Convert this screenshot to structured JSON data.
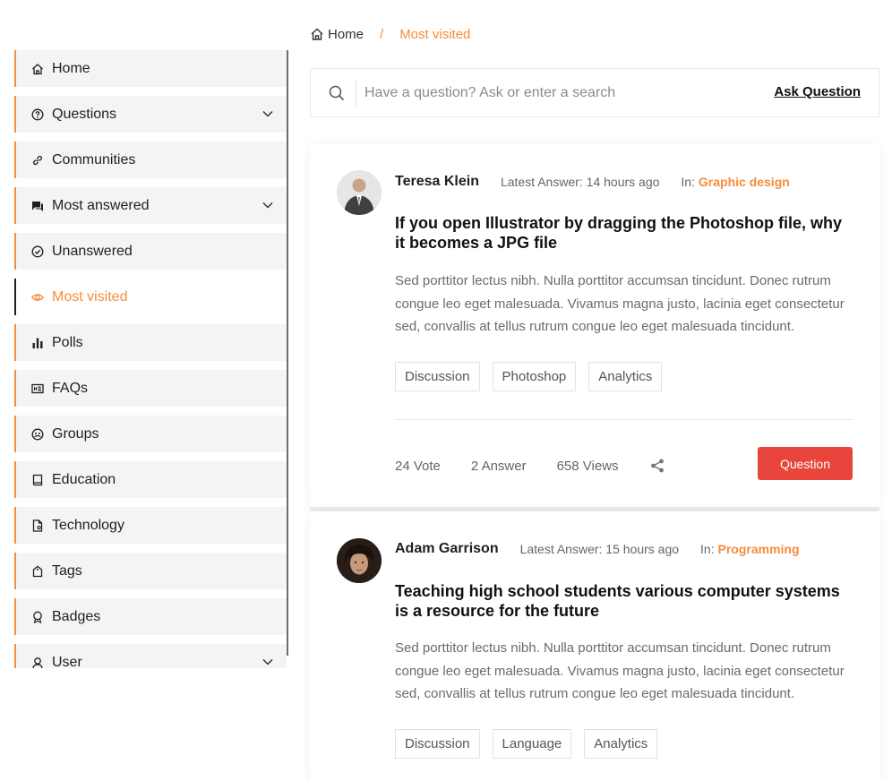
{
  "breadcrumb": {
    "home": "Home",
    "separator": "/",
    "current": "Most visited"
  },
  "search": {
    "placeholder": "Have a question? Ask or enter a search",
    "ask_label": "Ask Question"
  },
  "sidebar": {
    "items": [
      {
        "label": "Home",
        "icon": "home-icon"
      },
      {
        "label": "Questions",
        "icon": "question-icon",
        "expandable": true
      },
      {
        "label": "Communities",
        "icon": "link-icon"
      },
      {
        "label": "Most answered",
        "icon": "chat-icon",
        "expandable": true
      },
      {
        "label": "Unanswered",
        "icon": "check-circle-icon"
      },
      {
        "label": "Most visited",
        "icon": "eye-icon",
        "active": true
      },
      {
        "label": "Polls",
        "icon": "bar-chart-icon"
      },
      {
        "label": "FAQs",
        "icon": "faq-icon"
      },
      {
        "label": "Groups",
        "icon": "groups-icon"
      },
      {
        "label": "Education",
        "icon": "book-icon"
      },
      {
        "label": "Technology",
        "icon": "document-icon"
      },
      {
        "label": "Tags",
        "icon": "tag-icon"
      },
      {
        "label": "Badges",
        "icon": "badge-icon"
      },
      {
        "label": "User",
        "icon": "user-icon",
        "expandable": true
      }
    ]
  },
  "questions": [
    {
      "author": "Teresa Klein",
      "latest": "Latest Answer: 14 hours ago",
      "in_label": "In:",
      "category": "Graphic design",
      "title": "If you open Illustrator by dragging the Photoshop file, why it becomes a JPG file",
      "body": "Sed porttitor lectus nibh. Nulla porttitor accumsan tincidunt. Donec rutrum congue leo eget malesuada. Vivamus magna justo, lacinia eget consectetur sed, convallis at tellus rutrum congue leo eget malesuada tincidunt.",
      "tags": [
        "Discussion",
        "Photoshop",
        "Analytics"
      ],
      "votes": "24 Vote",
      "answers": "2 Answer",
      "views": "658 Views",
      "button": "Question"
    },
    {
      "author": "Adam Garrison",
      "latest": "Latest Answer: 15 hours ago",
      "in_label": "In:",
      "category": "Programming",
      "title": "Teaching high school students various computer systems is a resource for the future",
      "body": "Sed porttitor lectus nibh. Nulla porttitor accumsan tincidunt. Donec rutrum congue leo eget malesuada. Vivamus magna justo, lacinia eget consectetur sed, convallis at tellus rutrum congue leo eget malesuada tincidunt.",
      "tags": [
        "Discussion",
        "Language",
        "Analytics"
      ]
    }
  ],
  "colors": {
    "accent": "#f78c3a",
    "button": "#e8453c",
    "sidebar_bg": "#f4f4f4"
  }
}
